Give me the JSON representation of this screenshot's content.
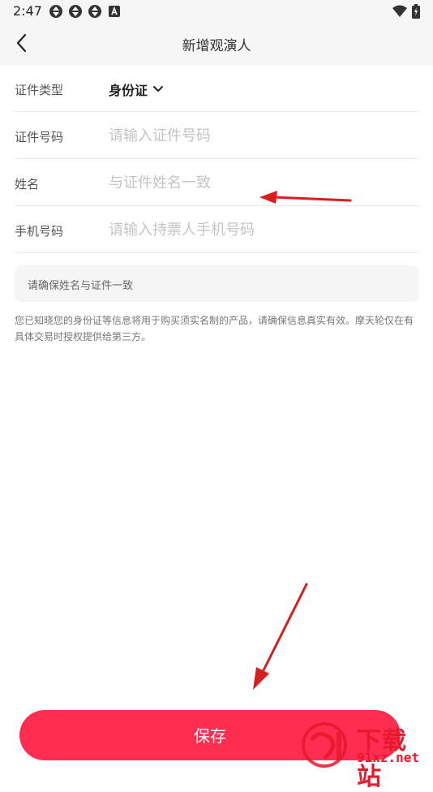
{
  "status_bar": {
    "time": "2:47",
    "left_icons": [
      "sync-icon",
      "sync-icon",
      "sync-icon",
      "a-icon"
    ],
    "right_icons": [
      "wifi-icon",
      "battery-icon"
    ]
  },
  "header": {
    "back_icon": "chevron-left-icon",
    "title": "新增观演人"
  },
  "form": {
    "id_type": {
      "label": "证件类型",
      "value": "身份证",
      "icon": "chevron-down-icon"
    },
    "id_number": {
      "label": "证件号码",
      "placeholder": "请输入证件号码",
      "value": ""
    },
    "name": {
      "label": "姓名",
      "placeholder": "与证件姓名一致",
      "value": ""
    },
    "phone": {
      "label": "手机号码",
      "placeholder": "请输入持票人手机号码",
      "value": ""
    }
  },
  "tip": "请确保姓名与证件一致",
  "notice": "您已知晓您的身份证等信息将用于购买须实名制的产品，请确保信息真实有效。摩天轮仅在有具体交易时授权提供给第三方。",
  "save_button": "保存",
  "watermark": {
    "logo_icon": "91-logo-icon",
    "text": "下载站",
    "domain": "91xz.net"
  },
  "colors": {
    "accent": "#ff2d50",
    "annotation_arrow": "#d81e1e",
    "header_bg": "#f6f6f6"
  }
}
